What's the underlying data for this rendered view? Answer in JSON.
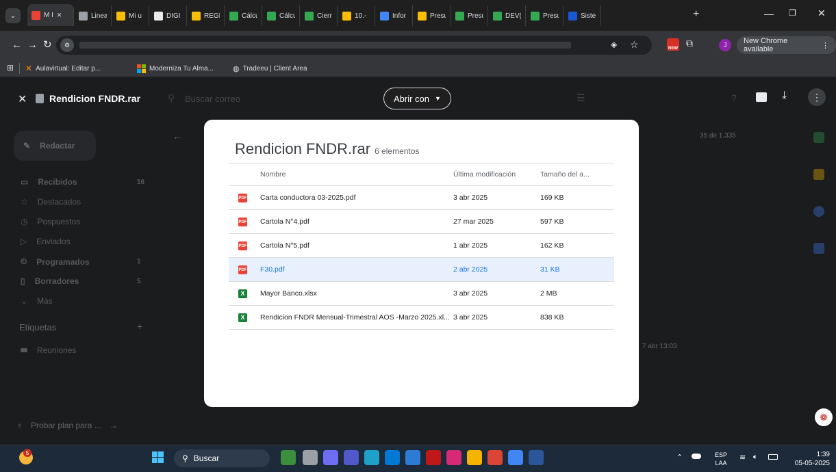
{
  "chrome": {
    "tabs": [
      {
        "label": "M I",
        "icon": "gmail-icon",
        "color": "#ea4335"
      },
      {
        "label": "Linea",
        "icon": "chrome-icon",
        "color": "#9aa0a6"
      },
      {
        "label": "Mi u",
        "icon": "drive-icon",
        "color": "#fbbc04"
      },
      {
        "label": "DIGI",
        "icon": "onedrive-icon",
        "color": "#e8eaed"
      },
      {
        "label": "REGL",
        "icon": "drive-icon",
        "color": "#fbbc04"
      },
      {
        "label": "Cálcu",
        "icon": "sheets-icon",
        "color": "#34a853"
      },
      {
        "label": "Cálcu",
        "icon": "sheets-icon",
        "color": "#34a853"
      },
      {
        "label": "Cierr",
        "icon": "sheets-icon",
        "color": "#34a853"
      },
      {
        "label": "10.-",
        "icon": "drive-icon",
        "color": "#fbbc04"
      },
      {
        "label": "Infor",
        "icon": "docs-icon",
        "color": "#4285f4"
      },
      {
        "label": "Presu",
        "icon": "drive-icon",
        "color": "#fbbc04"
      },
      {
        "label": "Presu",
        "icon": "sheets-icon",
        "color": "#34a853"
      },
      {
        "label": "DEV(",
        "icon": "sheets-icon",
        "color": "#34a853"
      },
      {
        "label": "Presu",
        "icon": "sheets-icon",
        "color": "#34a853"
      },
      {
        "label": "Siste",
        "icon": "site-icon",
        "color": "#1a57d6"
      }
    ],
    "new_tab": "+",
    "update_label": "New Chrome available",
    "profile_initial": "J",
    "bookmarks": [
      {
        "label": "Aulavirtual: Editar p...",
        "icon": "moodle-icon"
      },
      {
        "label": "Moderniza Tu Alma...",
        "icon": "microsoft-icon"
      },
      {
        "label": "Tradeeu | Client Area",
        "icon": "globe-icon"
      }
    ]
  },
  "viewer": {
    "file_title": "Rendicion FNDR.rar",
    "search_placeholder": "Buscar correo",
    "open_with": "Abrir con"
  },
  "gmail": {
    "compose": "Redactar",
    "nav": [
      {
        "label": "Recibidos",
        "count": "16",
        "icon": "inbox-icon",
        "bold": true
      },
      {
        "label": "Destacados",
        "count": "",
        "icon": "star-icon",
        "bold": false
      },
      {
        "label": "Pospuestos",
        "count": "",
        "icon": "clock-icon",
        "bold": false
      },
      {
        "label": "Enviados",
        "count": "",
        "icon": "send-icon",
        "bold": false
      },
      {
        "label": "Programados",
        "count": "1",
        "icon": "schedule-icon",
        "bold": true
      },
      {
        "label": "Borradores",
        "count": "5",
        "icon": "draft-icon",
        "bold": true
      },
      {
        "label": "Más",
        "count": "",
        "icon": "chevron-down-icon",
        "bold": false
      }
    ],
    "labels_title": "Etiquetas",
    "labels": [
      "Reuniones"
    ],
    "pagination": "35 de 1.335",
    "mail_date": "7 abr 13:03",
    "try_plan": "Probar plan para ..."
  },
  "archive": {
    "title": "Rendicion FNDR.rar",
    "count": "6 elementos",
    "columns": [
      "Nombre",
      "Última modificación",
      "Tamaño del a..."
    ],
    "files": [
      {
        "name": "Carta conductora 03-2025.pdf",
        "modified": "3 abr 2025",
        "size": "169 KB",
        "type": "pdf",
        "selected": false
      },
      {
        "name": "Cartola N°4.pdf",
        "modified": "27 mar 2025",
        "size": "597 KB",
        "type": "pdf",
        "selected": false
      },
      {
        "name": "Cartola N°5.pdf",
        "modified": "1 abr 2025",
        "size": "162 KB",
        "type": "pdf",
        "selected": false
      },
      {
        "name": "F30.pdf",
        "modified": "2 abr 2025",
        "size": "31 KB",
        "type": "pdf",
        "selected": true
      },
      {
        "name": "Mayor Banco.xlsx",
        "modified": "3 abr 2025",
        "size": "2 MB",
        "type": "xlsx",
        "selected": false
      },
      {
        "name": "Rendicion FNDR Mensual-Trimestral AOS -Marzo 2025.xl...",
        "modified": "3 abr 2025",
        "size": "838 KB",
        "type": "xlsx",
        "selected": false
      }
    ]
  },
  "taskbar": {
    "notification_badge": "5",
    "search_label": "Buscar",
    "lang_top": "ESP",
    "lang_bottom": "LAA",
    "time": "1:39",
    "date": "05-05-2025"
  }
}
